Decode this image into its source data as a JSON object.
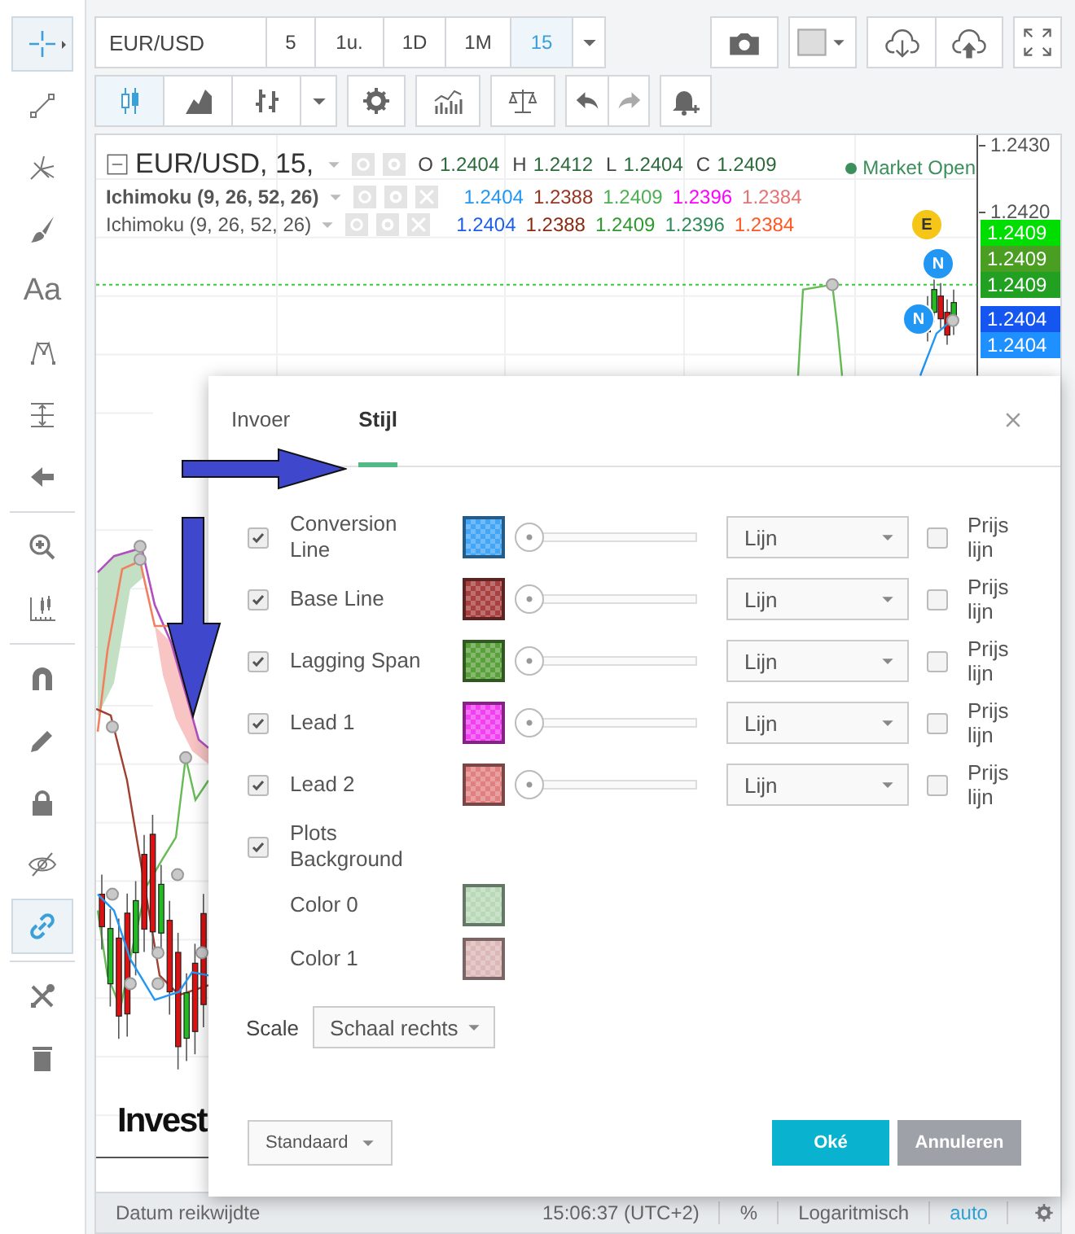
{
  "tool_groups": [
    [
      {
        "kind": "crosshair",
        "selected": true
      },
      {
        "kind": "trend-line",
        "selected": false
      },
      {
        "kind": "pitchfork",
        "selected": false
      },
      {
        "kind": "brush",
        "selected": false
      },
      {
        "kind": "text",
        "label": "Aa",
        "selected": false
      },
      {
        "kind": "pattern",
        "selected": false
      },
      {
        "kind": "measure",
        "selected": false
      },
      {
        "kind": "arrow",
        "selected": false
      }
    ],
    [
      {
        "kind": "zoom",
        "selected": false
      },
      {
        "kind": "ruler",
        "selected": false
      }
    ],
    [
      {
        "kind": "magnet",
        "selected": false
      },
      {
        "kind": "pencil",
        "selected": false
      },
      {
        "kind": "lock",
        "selected": false
      },
      {
        "kind": "hide",
        "selected": false
      },
      {
        "kind": "link",
        "selected": true
      }
    ],
    [
      {
        "kind": "tools",
        "selected": false
      },
      {
        "kind": "trash",
        "selected": false
      }
    ]
  ],
  "toolbar": {
    "symbol": "EUR/USD",
    "intervals": [
      {
        "label": "5",
        "selected": false
      },
      {
        "label": "1u.",
        "selected": false
      },
      {
        "label": "1D",
        "selected": false
      },
      {
        "label": "1M",
        "selected": false
      },
      {
        "label": "15",
        "selected": true
      }
    ],
    "chart_types": [
      {
        "kind": "candles",
        "selected": true
      },
      {
        "kind": "area",
        "selected": false
      },
      {
        "kind": "bars",
        "selected": false
      }
    ]
  },
  "legend": {
    "title": "EUR/USD, 15,",
    "ohlc": [
      {
        "label": "O",
        "value": "1.2404"
      },
      {
        "label": "H",
        "value": "1.2412"
      },
      {
        "label": "L",
        "value": "1.2404"
      },
      {
        "label": "C",
        "value": "1.2409"
      }
    ],
    "status": "Market Open",
    "indicators": [
      {
        "name": "Ichimoku (9, 26, 52, 26)",
        "highlighted": true,
        "values": [
          {
            "value": "1.2404",
            "color": "#2196f3"
          },
          {
            "value": "1.2388",
            "color": "#993322"
          },
          {
            "value": "1.2409",
            "color": "#4caf50"
          },
          {
            "value": "1.2396",
            "color": "#ff00ff"
          },
          {
            "value": "1.2384",
            "color": "#e57373"
          }
        ]
      },
      {
        "name": "Ichimoku (9, 26, 52, 26)",
        "highlighted": false,
        "values": [
          {
            "value": "1.2404",
            "color": "#1e5ee6"
          },
          {
            "value": "1.2388",
            "color": "#8b2a12"
          },
          {
            "value": "1.2409",
            "color": "#2e9a2e"
          },
          {
            "value": "1.2396",
            "color": "#2e8b57"
          },
          {
            "value": "1.2384",
            "color": "#ff5722"
          }
        ]
      }
    ]
  },
  "price_axis": {
    "ticks": [
      "1.2430",
      "1.2420"
    ],
    "tags": [
      {
        "value": "1.2409",
        "color": "#00dd00"
      },
      {
        "value": "1.2409",
        "color": "#4a9e22"
      },
      {
        "value": "1.2409",
        "color": "#22a022"
      },
      {
        "value": "1.2404",
        "color": "#1555f0"
      },
      {
        "value": "1.2404",
        "color": "#1e90ff"
      }
    ]
  },
  "events": [
    {
      "label": "E",
      "color": "#f5c518"
    },
    {
      "label": "N",
      "color": "#2196f3"
    },
    {
      "label": "N",
      "color": "#2196f3"
    }
  ],
  "chart_logo": "Invest",
  "dialog": {
    "tabs": [
      {
        "label": "Invoer",
        "selected": false
      },
      {
        "label": "Stijl",
        "selected": true
      }
    ],
    "plots": [
      {
        "label": "Conversion Line",
        "checked": true,
        "color": "#42a5f5",
        "level": 0,
        "style": "Lijn",
        "price_line": false,
        "price_line_label": "Prijs lijn"
      },
      {
        "label": "Base Line",
        "checked": true,
        "color": "#a84040",
        "level": 0,
        "style": "Lijn",
        "price_line": false,
        "price_line_label": "Prijs lijn"
      },
      {
        "label": "Lagging Span",
        "checked": true,
        "color": "#5aa03c",
        "level": 0,
        "style": "Lijn",
        "price_line": false,
        "price_line_label": "Prijs lijn"
      },
      {
        "label": "Lead 1",
        "checked": true,
        "color": "#f040f0",
        "level": 0,
        "style": "Lijn",
        "price_line": false,
        "price_line_label": "Prijs lijn"
      },
      {
        "label": "Lead 2",
        "checked": true,
        "color": "#e08080",
        "level": 0,
        "style": "Lijn",
        "price_line": false,
        "price_line_label": "Prijs lijn"
      }
    ],
    "background": {
      "label": "Plots Background",
      "checked": true,
      "colors": [
        {
          "label": "Color 0",
          "color": "#b8d8b8"
        },
        {
          "label": "Color 1",
          "color": "#dcb8b8"
        }
      ]
    },
    "scale": {
      "label": "Scale",
      "value": "Schaal rechts"
    },
    "defaults": "Standaard",
    "ok": "Oké",
    "cancel": "Annuleren"
  },
  "status_bar": {
    "range": "Datum reikwijdte",
    "time": "15:06:37 (UTC+2)",
    "scale_modes": [
      {
        "label": "%",
        "selected": false
      },
      {
        "label": "Logaritmisch",
        "selected": false
      },
      {
        "label": "auto",
        "selected": true
      }
    ]
  }
}
